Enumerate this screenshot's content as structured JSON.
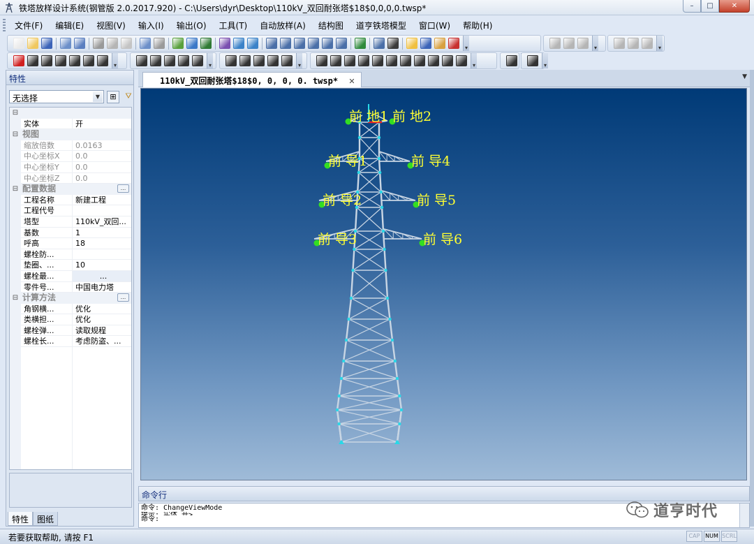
{
  "window": {
    "title": "铁塔放样设计系统(钢管版 2.0.2017.920) - C:\\Users\\dyr\\Desktop\\110kV_双回耐张塔$18$0,0,0,0.twsp*",
    "minimize": "–",
    "maximize": "□",
    "close": "✕"
  },
  "menu": [
    "文件(F)",
    "编辑(E)",
    "视图(V)",
    "输入(I)",
    "输出(O)",
    "工具(T)",
    "自动放样(A)",
    "结构图",
    "道亨铁塔模型",
    "窗口(W)",
    "帮助(H)"
  ],
  "toolbar_colors": {
    "row1": [
      "#eaeaea",
      "#f0c860",
      "#3b63b8",
      "#6c8fc9",
      "#5b7fc0",
      "#999999",
      "#b5b5b5",
      "#c4c4c4",
      "#6c8fc9",
      "#9a9a9a",
      "#58a03c",
      "#3b78c8",
      "#2f7a34",
      "#7a4fb0",
      "#3a82c8",
      "#3a82c8",
      "#4a6fa8",
      "#4a6fa8",
      "#4a6fa8",
      "#4a6fa8",
      "#4a6fa8",
      "#4a6fa8",
      "#2f8a3c",
      "#4a6fa8",
      "#3a3a3a",
      "#f0c040",
      "#3b63b8",
      "#d8a040",
      "#c83030",
      "#b5b5b5",
      "#b5b5b5",
      "#b5b5b5",
      "#b5b5b5",
      "#b5b5b5",
      "#b5b5b5"
    ],
    "row2": [
      "#d02020",
      "#333333",
      "#333333",
      "#333333",
      "#333333",
      "#333333",
      "#333333",
      "#333333",
      "#333333",
      "#333333",
      "#333333",
      "#333333",
      "#333333",
      "#333333",
      "#333333",
      "#333333",
      "#333333",
      "#333333",
      "#333333",
      "#333333",
      "#333333",
      "#333333",
      "#333333",
      "#333333",
      "#333333",
      "#333333",
      "#333333",
      "#333333",
      "#333333",
      "#333333"
    ]
  },
  "properties_panel": {
    "title": "特性",
    "selection": "无选择",
    "tabs": [
      "特性",
      "图纸"
    ],
    "rows": [
      {
        "kind": "cat",
        "name": "",
        "toggle": "⊟"
      },
      {
        "kind": "prop",
        "name": "实体",
        "value": "开"
      },
      {
        "kind": "cat",
        "name": "视图",
        "toggle": "⊟"
      },
      {
        "kind": "prop",
        "name": "缩放倍数",
        "value": "0.0163",
        "disabled": true
      },
      {
        "kind": "prop",
        "name": "中心坐标X",
        "value": "0.0",
        "disabled": true
      },
      {
        "kind": "prop",
        "name": "中心坐标Y",
        "value": "0.0",
        "disabled": true
      },
      {
        "kind": "prop",
        "name": "中心坐标Z",
        "value": "0.0",
        "disabled": true
      },
      {
        "kind": "cat",
        "name": "配置数据",
        "toggle": "⊟",
        "button": "..."
      },
      {
        "kind": "prop",
        "name": "工程名称",
        "value": "新建工程"
      },
      {
        "kind": "prop",
        "name": "工程代号",
        "value": ""
      },
      {
        "kind": "prop",
        "name": "塔型",
        "value": "110kV_双回..."
      },
      {
        "kind": "prop",
        "name": "基数",
        "value": "1"
      },
      {
        "kind": "prop",
        "name": "呼高",
        "value": "18"
      },
      {
        "kind": "prop",
        "name": "螺栓防...",
        "value": ""
      },
      {
        "kind": "prop",
        "name": "垫圈、...",
        "value": "10"
      },
      {
        "kind": "prop",
        "name": "螺栓最...",
        "value": "...",
        "centered": true
      },
      {
        "kind": "prop",
        "name": "零件号...",
        "value": "中国电力塔"
      },
      {
        "kind": "cat",
        "name": "计算方法",
        "toggle": "⊟",
        "button": "..."
      },
      {
        "kind": "prop",
        "name": "角钢横...",
        "value": "优化"
      },
      {
        "kind": "prop",
        "name": "类横担...",
        "value": "优化"
      },
      {
        "kind": "prop",
        "name": "螺栓弹...",
        "value": "读取规程"
      },
      {
        "kind": "prop",
        "name": "螺栓长...",
        "value": "考虑防盗、..."
      }
    ]
  },
  "document": {
    "tab_label": "110kV_双回耐张塔$18$0, 0, 0, 0. twsp*",
    "tab_close": "✕",
    "labels": {
      "ground1": "前 地1",
      "ground2": "前 地2",
      "cond1": "前 导1",
      "cond2": "前 导2",
      "cond3": "前 导3",
      "cond4": "前 导4",
      "cond5": "前 导5",
      "cond6": "前 导6"
    },
    "colors": {
      "bg_top": "#003a77",
      "bg_bottom": "#9fbbd8",
      "member": "#c9d6e4",
      "node": "#29d8e8",
      "label": "#ffff33",
      "hang_point": "#33dd22",
      "axis_red": "#ee2222"
    }
  },
  "command": {
    "title": "命令行",
    "lines": [
      "命令: ChangeViewMode",
      "提示: 实体 开>",
      "命令:"
    ]
  },
  "watermark": {
    "text": "道亨时代"
  },
  "status": {
    "help": "若要获取帮助, 请按 F1",
    "indicators": [
      {
        "label": "CAP",
        "on": false
      },
      {
        "label": "NUM",
        "on": true
      },
      {
        "label": "SCRL",
        "on": false
      }
    ]
  }
}
